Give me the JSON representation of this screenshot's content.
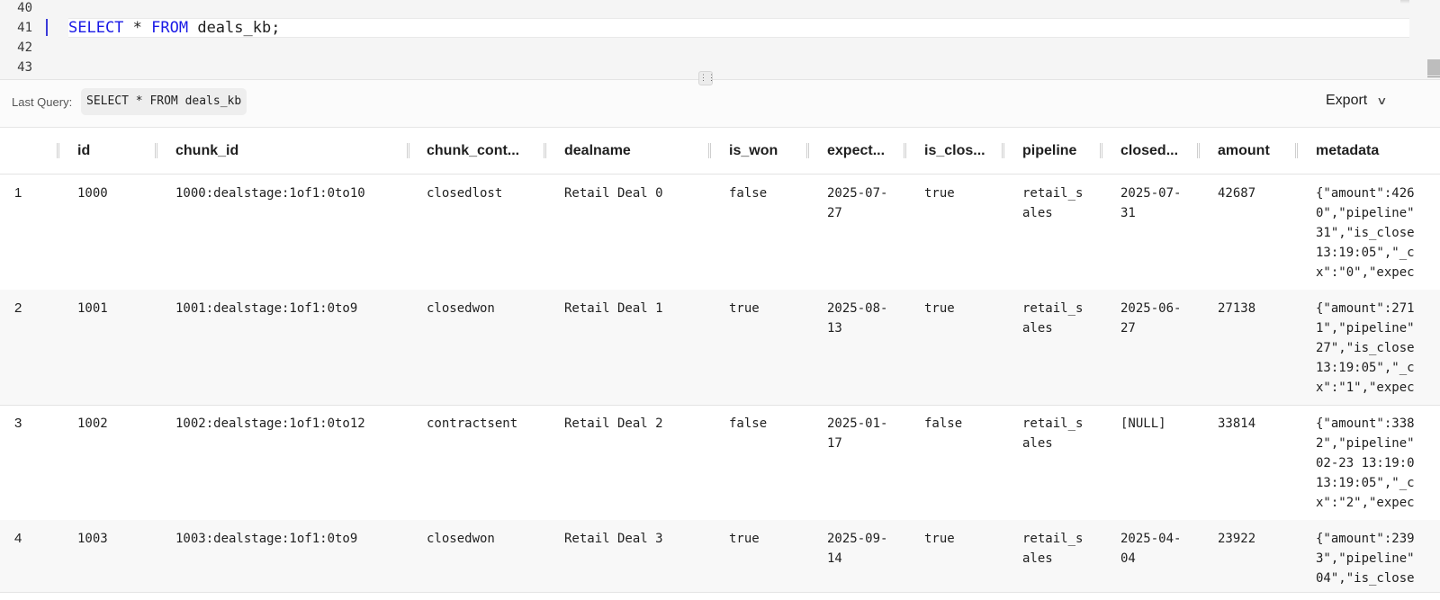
{
  "editor": {
    "line_numbers": [
      "40",
      "41",
      "42",
      "43"
    ],
    "code": {
      "kw1": "SELECT",
      "op": " * ",
      "kw2": "FROM",
      "rest": " deals_kb;"
    }
  },
  "query_bar": {
    "label": "Last Query:",
    "query": "SELECT * FROM deals_kb",
    "export_label": "Export"
  },
  "table": {
    "columns": [
      "id",
      "chunk_id",
      "chunk_cont...",
      "dealname",
      "is_won",
      "expect...",
      "is_clos...",
      "pipeline",
      "closed...",
      "amount",
      "metadata"
    ],
    "rows": [
      {
        "index": "1",
        "id": "1000",
        "chunk_id": "1000:dealstage:1of1:0to10",
        "chunk_content": "closedlost",
        "dealname": "Retail Deal 0",
        "is_won": "false",
        "expected": "2025-07-\n27",
        "is_closed": "true",
        "pipeline": "retail_s\nales",
        "closed": "2025-07-\n31",
        "amount": "42687",
        "metadata": "{\"amount\":426\n0\",\"pipeline\"\n31\",\"is_close\n13:19:05\",\"_c\nx\":\"0\",\"expec"
      },
      {
        "index": "2",
        "id": "1001",
        "chunk_id": "1001:dealstage:1of1:0to9",
        "chunk_content": "closedwon",
        "dealname": "Retail Deal 1",
        "is_won": "true",
        "expected": "2025-08-\n13",
        "is_closed": "true",
        "pipeline": "retail_s\nales",
        "closed": "2025-06-\n27",
        "amount": "27138",
        "metadata": "{\"amount\":271\n1\",\"pipeline\"\n27\",\"is_close\n13:19:05\",\"_c\nx\":\"1\",\"expec"
      },
      {
        "index": "3",
        "id": "1002",
        "chunk_id": "1002:dealstage:1of1:0to12",
        "chunk_content": "contractsent",
        "dealname": "Retail Deal 2",
        "is_won": "false",
        "expected": "2025-01-\n17",
        "is_closed": "false",
        "pipeline": "retail_s\nales",
        "closed": "[NULL]",
        "amount": "33814",
        "metadata": "{\"amount\":338\n2\",\"pipeline\"\n02-23 13:19:0\n13:19:05\",\"_c\nx\":\"2\",\"expec"
      },
      {
        "index": "4",
        "id": "1003",
        "chunk_id": "1003:dealstage:1of1:0to9",
        "chunk_content": "closedwon",
        "dealname": "Retail Deal 3",
        "is_won": "true",
        "expected": "2025-09-\n14",
        "is_closed": "true",
        "pipeline": "retail_s\nales",
        "closed": "2025-04-\n04",
        "amount": "23922",
        "metadata": "{\"amount\":239\n3\",\"pipeline\"\n04\",\"is_close"
      }
    ]
  }
}
